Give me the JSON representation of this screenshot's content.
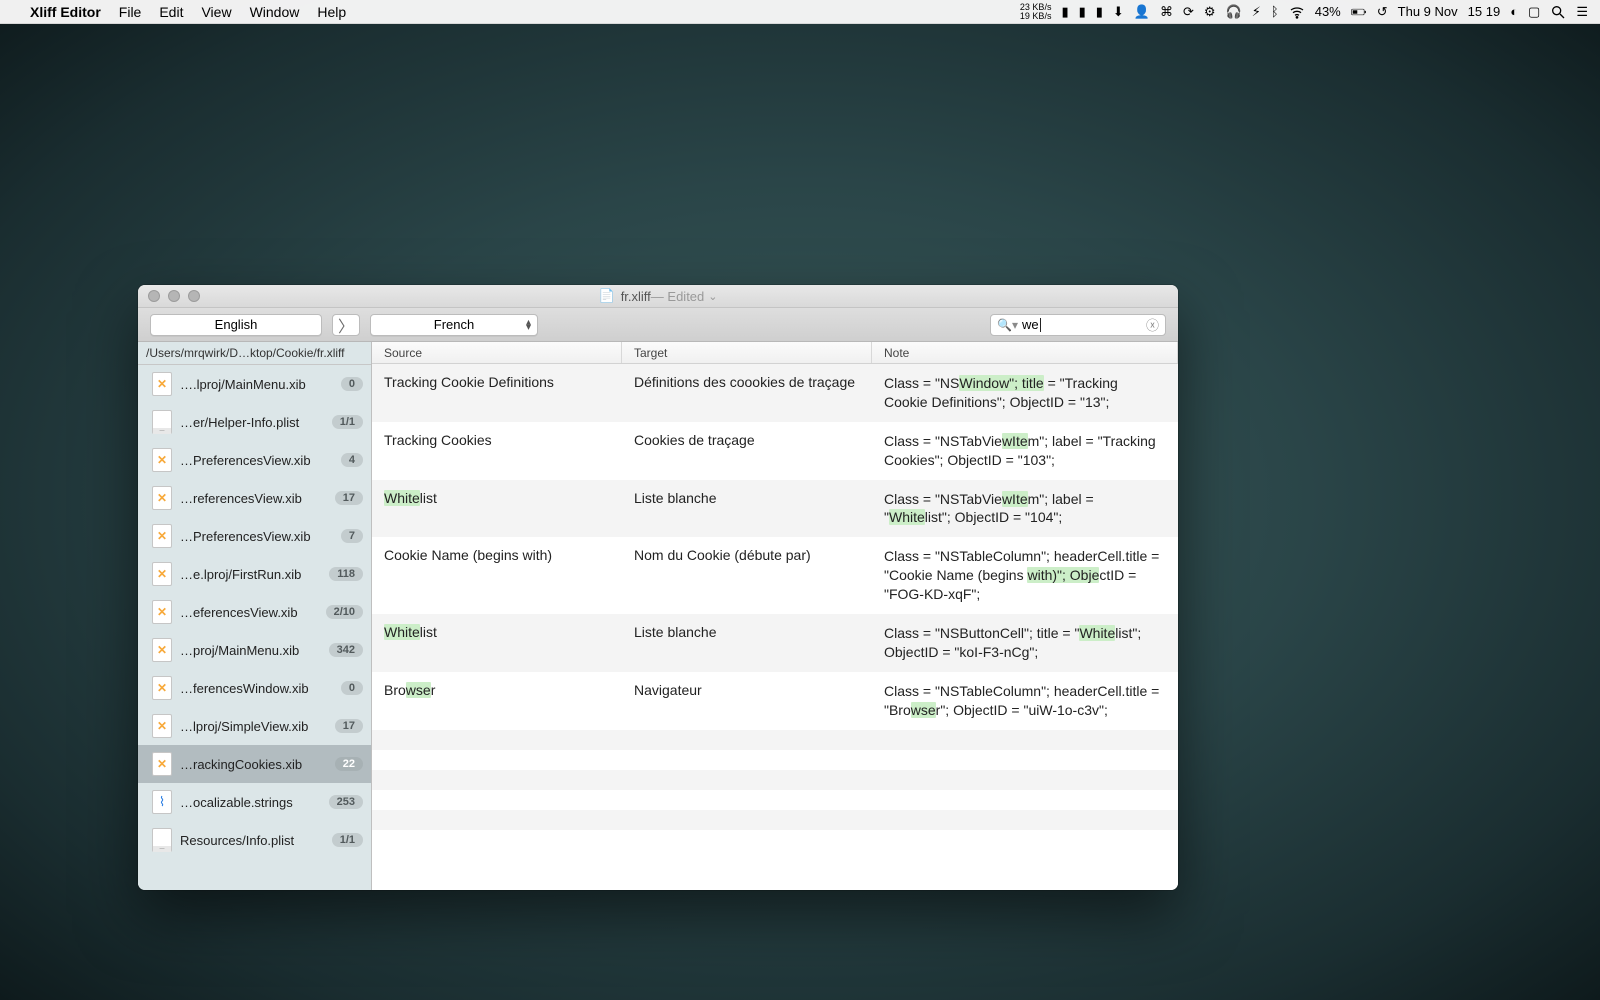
{
  "menubar": {
    "app": "Xliff Editor",
    "items": [
      "File",
      "Edit",
      "View",
      "Window",
      "Help"
    ],
    "net_up": "23 KB/s",
    "net_down": "19 KB/s",
    "battery": "43%",
    "date": "Thu 9 Nov",
    "time": "15 19"
  },
  "window": {
    "title": "fr.xliff",
    "edited": " — Edited",
    "source_lang": "English",
    "target_lang": "French",
    "search_value": "we"
  },
  "sidebar": {
    "path": "/Users/mrqwirk/D…ktop/Cookie/fr.xliff",
    "files": [
      {
        "name": "….lproj/MainMenu.xib",
        "badge": "0",
        "icon": "xib"
      },
      {
        "name": "…er/Helper-Info.plist",
        "badge": "1/1",
        "icon": "plist"
      },
      {
        "name": "…PreferencesView.xib",
        "badge": "4",
        "icon": "xib"
      },
      {
        "name": "…referencesView.xib",
        "badge": "17",
        "icon": "xib"
      },
      {
        "name": "…PreferencesView.xib",
        "badge": "7",
        "icon": "xib"
      },
      {
        "name": "…e.lproj/FirstRun.xib",
        "badge": "118",
        "icon": "xib"
      },
      {
        "name": "…eferencesView.xib",
        "badge": "2/10",
        "icon": "xib"
      },
      {
        "name": "…proj/MainMenu.xib",
        "badge": "342",
        "icon": "xib"
      },
      {
        "name": "…ferencesWindow.xib",
        "badge": "0",
        "icon": "xib"
      },
      {
        "name": "…lproj/SimpleView.xib",
        "badge": "17",
        "icon": "xib"
      },
      {
        "name": "…rackingCookies.xib",
        "badge": "22",
        "icon": "xib",
        "selected": true
      },
      {
        "name": "…ocalizable.strings",
        "badge": "253",
        "icon": "strings"
      },
      {
        "name": "Resources/Info.plist",
        "badge": "1/1",
        "icon": "plist"
      }
    ]
  },
  "table": {
    "headers": {
      "source": "Source",
      "target": "Target",
      "note": "Note"
    },
    "rows": [
      {
        "source_parts": [
          [
            "",
            "Tracking Cookie Definitions"
          ]
        ],
        "target": "Définitions des coookies de traçage",
        "note_parts": [
          "Class = \"NS",
          [
            "hl",
            "Window\"; title"
          ],
          " = \"Tracking Cookie Definitions\"; ObjectID = \"13\";"
        ]
      },
      {
        "source_parts": [
          [
            "",
            "Tracking Cookies"
          ]
        ],
        "target": "Cookies de traçage",
        "note_parts": [
          "Class = \"NSTabVie",
          [
            "hl",
            "wIte"
          ],
          "m\"; label = \"Tracking Cookies\"; ObjectID = \"103\";"
        ]
      },
      {
        "source_parts": [
          [
            "hl",
            "White"
          ],
          [
            "",
            "list"
          ]
        ],
        "target": "Liste blanche",
        "note_parts": [
          "Class = \"NSTabVie",
          [
            "hl",
            "wIte"
          ],
          "m\"; label = \"",
          [
            "hl",
            "White"
          ],
          "list\"; ObjectID = \"104\";"
        ]
      },
      {
        "source_parts": [
          [
            "",
            "Cookie Name (begins with)"
          ]
        ],
        "target": "Nom du Cookie (débute par)",
        "note_parts": [
          "Class = \"NSTableColumn\"; headerCell.title = \"Cookie Name (begins ",
          [
            "hl",
            "with)\"; Obje"
          ],
          "ctID = \"FOG-KD-xqF\";"
        ]
      },
      {
        "source_parts": [
          [
            "hl",
            "White"
          ],
          [
            "",
            "list"
          ]
        ],
        "target": "Liste blanche",
        "note_parts": [
          "Class = \"NSButtonCell\"; title = \"",
          [
            "hl",
            "White"
          ],
          "list\"; ObjectID = \"koI-F3-nCg\";"
        ]
      },
      {
        "source_parts": [
          [
            "",
            "Bro"
          ],
          [
            "hl",
            "wse"
          ],
          [
            "",
            "r"
          ]
        ],
        "target": "Navigateur",
        "note_parts": [
          "Class = \"NSTableColumn\"; headerCell.title = \"Bro",
          [
            "hl",
            "wse"
          ],
          "r\"; ObjectID = \"uiW-1o-c3v\";"
        ]
      }
    ]
  }
}
